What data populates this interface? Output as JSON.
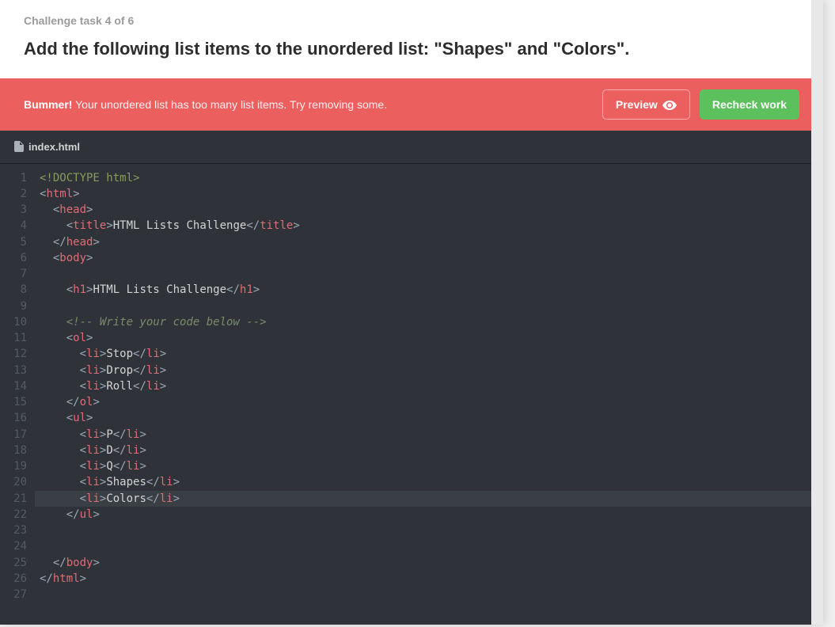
{
  "header": {
    "task_label": "Challenge task 4 of 6",
    "instruction": "Add the following list items to the unordered list: \"Shapes\" and \"Colors\"."
  },
  "alert": {
    "strong": "Bummer!",
    "message": "Your unordered list has too many list items. Try removing some.",
    "preview_label": "Preview",
    "recheck_label": "Recheck work"
  },
  "tab": {
    "filename": "index.html"
  },
  "code": {
    "lines": [
      {
        "n": 1,
        "segs": [
          {
            "c": "doctype",
            "t": "<!DOCTYPE html>"
          }
        ]
      },
      {
        "n": 2,
        "segs": [
          {
            "c": "tag-bracket",
            "t": "<"
          },
          {
            "c": "tag-name",
            "t": "html"
          },
          {
            "c": "tag-bracket",
            "t": ">"
          }
        ]
      },
      {
        "n": 3,
        "segs": [
          {
            "c": "plain",
            "t": "  "
          },
          {
            "c": "tag-bracket",
            "t": "<"
          },
          {
            "c": "tag-name",
            "t": "head"
          },
          {
            "c": "tag-bracket",
            "t": ">"
          }
        ]
      },
      {
        "n": 4,
        "segs": [
          {
            "c": "plain",
            "t": "    "
          },
          {
            "c": "tag-bracket",
            "t": "<"
          },
          {
            "c": "tag-name",
            "t": "title"
          },
          {
            "c": "tag-bracket",
            "t": ">"
          },
          {
            "c": "attr-text",
            "t": "HTML Lists Challenge"
          },
          {
            "c": "tag-bracket",
            "t": "</"
          },
          {
            "c": "tag-name",
            "t": "title"
          },
          {
            "c": "tag-bracket",
            "t": ">"
          }
        ]
      },
      {
        "n": 5,
        "segs": [
          {
            "c": "plain",
            "t": "  "
          },
          {
            "c": "tag-bracket",
            "t": "</"
          },
          {
            "c": "tag-name",
            "t": "head"
          },
          {
            "c": "tag-bracket",
            "t": ">"
          }
        ]
      },
      {
        "n": 6,
        "segs": [
          {
            "c": "plain",
            "t": "  "
          },
          {
            "c": "tag-bracket",
            "t": "<"
          },
          {
            "c": "tag-name",
            "t": "body"
          },
          {
            "c": "tag-bracket",
            "t": ">"
          }
        ]
      },
      {
        "n": 7,
        "segs": []
      },
      {
        "n": 8,
        "segs": [
          {
            "c": "plain",
            "t": "    "
          },
          {
            "c": "tag-bracket",
            "t": "<"
          },
          {
            "c": "tag-name",
            "t": "h1"
          },
          {
            "c": "tag-bracket",
            "t": ">"
          },
          {
            "c": "attr-text",
            "t": "HTML Lists Challenge"
          },
          {
            "c": "tag-bracket",
            "t": "</"
          },
          {
            "c": "tag-name",
            "t": "h1"
          },
          {
            "c": "tag-bracket",
            "t": ">"
          }
        ]
      },
      {
        "n": 9,
        "segs": []
      },
      {
        "n": 10,
        "segs": [
          {
            "c": "plain",
            "t": "    "
          },
          {
            "c": "comment",
            "t": "<!-- Write your code below -->"
          }
        ]
      },
      {
        "n": 11,
        "segs": [
          {
            "c": "plain",
            "t": "    "
          },
          {
            "c": "tag-bracket",
            "t": "<"
          },
          {
            "c": "tag-name",
            "t": "ol"
          },
          {
            "c": "tag-bracket",
            "t": ">"
          }
        ]
      },
      {
        "n": 12,
        "segs": [
          {
            "c": "plain",
            "t": "      "
          },
          {
            "c": "tag-bracket",
            "t": "<"
          },
          {
            "c": "tag-name",
            "t": "li"
          },
          {
            "c": "tag-bracket",
            "t": ">"
          },
          {
            "c": "attr-text",
            "t": "Stop"
          },
          {
            "c": "tag-bracket",
            "t": "</"
          },
          {
            "c": "tag-name",
            "t": "li"
          },
          {
            "c": "tag-bracket",
            "t": ">"
          }
        ]
      },
      {
        "n": 13,
        "segs": [
          {
            "c": "plain",
            "t": "      "
          },
          {
            "c": "tag-bracket",
            "t": "<"
          },
          {
            "c": "tag-name",
            "t": "li"
          },
          {
            "c": "tag-bracket",
            "t": ">"
          },
          {
            "c": "attr-text",
            "t": "Drop"
          },
          {
            "c": "tag-bracket",
            "t": "</"
          },
          {
            "c": "tag-name",
            "t": "li"
          },
          {
            "c": "tag-bracket",
            "t": ">"
          }
        ]
      },
      {
        "n": 14,
        "segs": [
          {
            "c": "plain",
            "t": "      "
          },
          {
            "c": "tag-bracket",
            "t": "<"
          },
          {
            "c": "tag-name",
            "t": "li"
          },
          {
            "c": "tag-bracket",
            "t": ">"
          },
          {
            "c": "attr-text",
            "t": "Roll"
          },
          {
            "c": "tag-bracket",
            "t": "</"
          },
          {
            "c": "tag-name",
            "t": "li"
          },
          {
            "c": "tag-bracket",
            "t": ">"
          }
        ]
      },
      {
        "n": 15,
        "segs": [
          {
            "c": "plain",
            "t": "    "
          },
          {
            "c": "tag-bracket",
            "t": "</"
          },
          {
            "c": "tag-name",
            "t": "ol"
          },
          {
            "c": "tag-bracket",
            "t": ">"
          }
        ]
      },
      {
        "n": 16,
        "segs": [
          {
            "c": "plain",
            "t": "    "
          },
          {
            "c": "tag-bracket",
            "t": "<"
          },
          {
            "c": "tag-name",
            "t": "ul"
          },
          {
            "c": "tag-bracket",
            "t": ">"
          }
        ]
      },
      {
        "n": 17,
        "segs": [
          {
            "c": "plain",
            "t": "      "
          },
          {
            "c": "tag-bracket",
            "t": "<"
          },
          {
            "c": "tag-name",
            "t": "li"
          },
          {
            "c": "tag-bracket",
            "t": ">"
          },
          {
            "c": "attr-text",
            "t": "P"
          },
          {
            "c": "tag-bracket",
            "t": "</"
          },
          {
            "c": "tag-name",
            "t": "li"
          },
          {
            "c": "tag-bracket",
            "t": ">"
          }
        ]
      },
      {
        "n": 18,
        "segs": [
          {
            "c": "plain",
            "t": "      "
          },
          {
            "c": "tag-bracket",
            "t": "<"
          },
          {
            "c": "tag-name",
            "t": "li"
          },
          {
            "c": "tag-bracket",
            "t": ">"
          },
          {
            "c": "attr-text",
            "t": "D"
          },
          {
            "c": "tag-bracket",
            "t": "</"
          },
          {
            "c": "tag-name",
            "t": "li"
          },
          {
            "c": "tag-bracket",
            "t": ">"
          }
        ]
      },
      {
        "n": 19,
        "segs": [
          {
            "c": "plain",
            "t": "      "
          },
          {
            "c": "tag-bracket",
            "t": "<"
          },
          {
            "c": "tag-name",
            "t": "li"
          },
          {
            "c": "tag-bracket",
            "t": ">"
          },
          {
            "c": "attr-text",
            "t": "Q"
          },
          {
            "c": "tag-bracket",
            "t": "</"
          },
          {
            "c": "tag-name",
            "t": "li"
          },
          {
            "c": "tag-bracket",
            "t": ">"
          }
        ]
      },
      {
        "n": 20,
        "segs": [
          {
            "c": "plain",
            "t": "      "
          },
          {
            "c": "tag-bracket",
            "t": "<"
          },
          {
            "c": "tag-name",
            "t": "li"
          },
          {
            "c": "tag-bracket",
            "t": ">"
          },
          {
            "c": "attr-text",
            "t": "Shapes"
          },
          {
            "c": "tag-bracket",
            "t": "</"
          },
          {
            "c": "tag-name",
            "t": "li"
          },
          {
            "c": "tag-bracket",
            "t": ">"
          }
        ]
      },
      {
        "n": 21,
        "hl": true,
        "segs": [
          {
            "c": "plain",
            "t": "      "
          },
          {
            "c": "tag-bracket",
            "t": "<"
          },
          {
            "c": "tag-name",
            "t": "li"
          },
          {
            "c": "tag-bracket",
            "t": ">"
          },
          {
            "c": "attr-text",
            "t": "Colors"
          },
          {
            "c": "tag-bracket",
            "t": "</"
          },
          {
            "c": "tag-name",
            "t": "li"
          },
          {
            "c": "tag-bracket",
            "t": ">"
          }
        ]
      },
      {
        "n": 22,
        "segs": [
          {
            "c": "plain",
            "t": "    "
          },
          {
            "c": "tag-bracket",
            "t": "</"
          },
          {
            "c": "tag-name",
            "t": "ul"
          },
          {
            "c": "tag-bracket",
            "t": ">"
          }
        ]
      },
      {
        "n": 23,
        "segs": []
      },
      {
        "n": 24,
        "segs": []
      },
      {
        "n": 25,
        "segs": [
          {
            "c": "plain",
            "t": "  "
          },
          {
            "c": "tag-bracket",
            "t": "</"
          },
          {
            "c": "tag-name",
            "t": "body"
          },
          {
            "c": "tag-bracket",
            "t": ">"
          }
        ]
      },
      {
        "n": 26,
        "segs": [
          {
            "c": "tag-bracket",
            "t": "</"
          },
          {
            "c": "tag-name",
            "t": "html"
          },
          {
            "c": "tag-bracket",
            "t": ">"
          }
        ]
      },
      {
        "n": 27,
        "segs": []
      }
    ]
  }
}
